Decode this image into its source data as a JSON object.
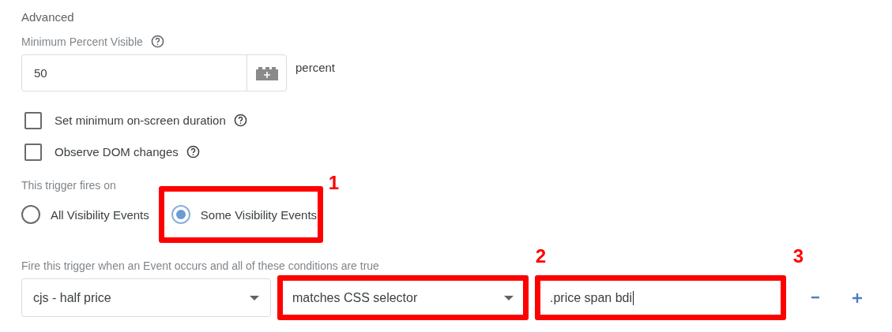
{
  "section_title": "Advanced",
  "percent_field": {
    "label": "Minimum Percent Visible",
    "value": "50",
    "unit": "percent"
  },
  "checkboxes": [
    {
      "label": "Set minimum on-screen duration",
      "checked": false
    },
    {
      "label": "Observe DOM changes",
      "checked": false
    }
  ],
  "fires_on": {
    "label": "This trigger fires on",
    "options": [
      {
        "label": "All Visibility Events",
        "selected": false
      },
      {
        "label": "Some Visibility Events",
        "selected": true,
        "callout": "1"
      }
    ]
  },
  "conditions": {
    "label": "Fire this trigger when an Event occurs and all of these conditions are true",
    "fields": [
      {
        "kind": "dropdown",
        "value": "cjs - half price"
      },
      {
        "kind": "dropdown",
        "value": "matches CSS selector",
        "callout": "2"
      },
      {
        "kind": "text",
        "value": ".price span bdi",
        "callout": "3"
      }
    ]
  }
}
